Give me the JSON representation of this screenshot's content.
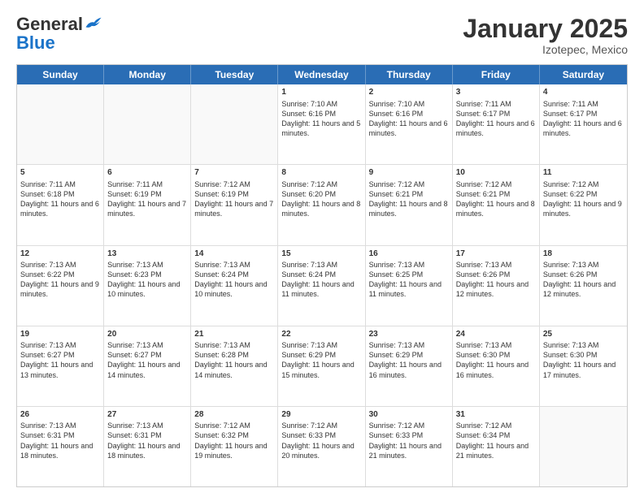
{
  "header": {
    "logo_general": "General",
    "logo_blue": "Blue",
    "month_title": "January 2025",
    "subtitle": "Izotepec, Mexico"
  },
  "days_of_week": [
    "Sunday",
    "Monday",
    "Tuesday",
    "Wednesday",
    "Thursday",
    "Friday",
    "Saturday"
  ],
  "weeks": [
    [
      {
        "day": "",
        "sunrise": "",
        "sunset": "",
        "daylight": ""
      },
      {
        "day": "",
        "sunrise": "",
        "sunset": "",
        "daylight": ""
      },
      {
        "day": "",
        "sunrise": "",
        "sunset": "",
        "daylight": ""
      },
      {
        "day": "1",
        "sunrise": "Sunrise: 7:10 AM",
        "sunset": "Sunset: 6:16 PM",
        "daylight": "Daylight: 11 hours and 5 minutes."
      },
      {
        "day": "2",
        "sunrise": "Sunrise: 7:10 AM",
        "sunset": "Sunset: 6:16 PM",
        "daylight": "Daylight: 11 hours and 6 minutes."
      },
      {
        "day": "3",
        "sunrise": "Sunrise: 7:11 AM",
        "sunset": "Sunset: 6:17 PM",
        "daylight": "Daylight: 11 hours and 6 minutes."
      },
      {
        "day": "4",
        "sunrise": "Sunrise: 7:11 AM",
        "sunset": "Sunset: 6:17 PM",
        "daylight": "Daylight: 11 hours and 6 minutes."
      }
    ],
    [
      {
        "day": "5",
        "sunrise": "Sunrise: 7:11 AM",
        "sunset": "Sunset: 6:18 PM",
        "daylight": "Daylight: 11 hours and 6 minutes."
      },
      {
        "day": "6",
        "sunrise": "Sunrise: 7:11 AM",
        "sunset": "Sunset: 6:19 PM",
        "daylight": "Daylight: 11 hours and 7 minutes."
      },
      {
        "day": "7",
        "sunrise": "Sunrise: 7:12 AM",
        "sunset": "Sunset: 6:19 PM",
        "daylight": "Daylight: 11 hours and 7 minutes."
      },
      {
        "day": "8",
        "sunrise": "Sunrise: 7:12 AM",
        "sunset": "Sunset: 6:20 PM",
        "daylight": "Daylight: 11 hours and 8 minutes."
      },
      {
        "day": "9",
        "sunrise": "Sunrise: 7:12 AM",
        "sunset": "Sunset: 6:21 PM",
        "daylight": "Daylight: 11 hours and 8 minutes."
      },
      {
        "day": "10",
        "sunrise": "Sunrise: 7:12 AM",
        "sunset": "Sunset: 6:21 PM",
        "daylight": "Daylight: 11 hours and 8 minutes."
      },
      {
        "day": "11",
        "sunrise": "Sunrise: 7:12 AM",
        "sunset": "Sunset: 6:22 PM",
        "daylight": "Daylight: 11 hours and 9 minutes."
      }
    ],
    [
      {
        "day": "12",
        "sunrise": "Sunrise: 7:13 AM",
        "sunset": "Sunset: 6:22 PM",
        "daylight": "Daylight: 11 hours and 9 minutes."
      },
      {
        "day": "13",
        "sunrise": "Sunrise: 7:13 AM",
        "sunset": "Sunset: 6:23 PM",
        "daylight": "Daylight: 11 hours and 10 minutes."
      },
      {
        "day": "14",
        "sunrise": "Sunrise: 7:13 AM",
        "sunset": "Sunset: 6:24 PM",
        "daylight": "Daylight: 11 hours and 10 minutes."
      },
      {
        "day": "15",
        "sunrise": "Sunrise: 7:13 AM",
        "sunset": "Sunset: 6:24 PM",
        "daylight": "Daylight: 11 hours and 11 minutes."
      },
      {
        "day": "16",
        "sunrise": "Sunrise: 7:13 AM",
        "sunset": "Sunset: 6:25 PM",
        "daylight": "Daylight: 11 hours and 11 minutes."
      },
      {
        "day": "17",
        "sunrise": "Sunrise: 7:13 AM",
        "sunset": "Sunset: 6:26 PM",
        "daylight": "Daylight: 11 hours and 12 minutes."
      },
      {
        "day": "18",
        "sunrise": "Sunrise: 7:13 AM",
        "sunset": "Sunset: 6:26 PM",
        "daylight": "Daylight: 11 hours and 12 minutes."
      }
    ],
    [
      {
        "day": "19",
        "sunrise": "Sunrise: 7:13 AM",
        "sunset": "Sunset: 6:27 PM",
        "daylight": "Daylight: 11 hours and 13 minutes."
      },
      {
        "day": "20",
        "sunrise": "Sunrise: 7:13 AM",
        "sunset": "Sunset: 6:27 PM",
        "daylight": "Daylight: 11 hours and 14 minutes."
      },
      {
        "day": "21",
        "sunrise": "Sunrise: 7:13 AM",
        "sunset": "Sunset: 6:28 PM",
        "daylight": "Daylight: 11 hours and 14 minutes."
      },
      {
        "day": "22",
        "sunrise": "Sunrise: 7:13 AM",
        "sunset": "Sunset: 6:29 PM",
        "daylight": "Daylight: 11 hours and 15 minutes."
      },
      {
        "day": "23",
        "sunrise": "Sunrise: 7:13 AM",
        "sunset": "Sunset: 6:29 PM",
        "daylight": "Daylight: 11 hours and 16 minutes."
      },
      {
        "day": "24",
        "sunrise": "Sunrise: 7:13 AM",
        "sunset": "Sunset: 6:30 PM",
        "daylight": "Daylight: 11 hours and 16 minutes."
      },
      {
        "day": "25",
        "sunrise": "Sunrise: 7:13 AM",
        "sunset": "Sunset: 6:30 PM",
        "daylight": "Daylight: 11 hours and 17 minutes."
      }
    ],
    [
      {
        "day": "26",
        "sunrise": "Sunrise: 7:13 AM",
        "sunset": "Sunset: 6:31 PM",
        "daylight": "Daylight: 11 hours and 18 minutes."
      },
      {
        "day": "27",
        "sunrise": "Sunrise: 7:13 AM",
        "sunset": "Sunset: 6:31 PM",
        "daylight": "Daylight: 11 hours and 18 minutes."
      },
      {
        "day": "28",
        "sunrise": "Sunrise: 7:12 AM",
        "sunset": "Sunset: 6:32 PM",
        "daylight": "Daylight: 11 hours and 19 minutes."
      },
      {
        "day": "29",
        "sunrise": "Sunrise: 7:12 AM",
        "sunset": "Sunset: 6:33 PM",
        "daylight": "Daylight: 11 hours and 20 minutes."
      },
      {
        "day": "30",
        "sunrise": "Sunrise: 7:12 AM",
        "sunset": "Sunset: 6:33 PM",
        "daylight": "Daylight: 11 hours and 21 minutes."
      },
      {
        "day": "31",
        "sunrise": "Sunrise: 7:12 AM",
        "sunset": "Sunset: 6:34 PM",
        "daylight": "Daylight: 11 hours and 21 minutes."
      },
      {
        "day": "",
        "sunrise": "",
        "sunset": "",
        "daylight": ""
      }
    ]
  ]
}
